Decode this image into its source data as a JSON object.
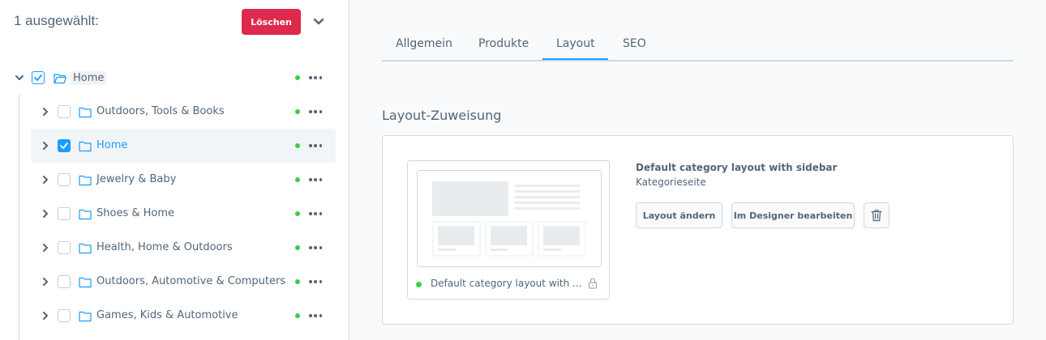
{
  "selection": {
    "title": "1 ausgewählt:",
    "delete_label": "Löschen"
  },
  "tree": {
    "root": {
      "label": "Home",
      "checked": true
    },
    "items": [
      {
        "label": "Outdoors, Tools & Books",
        "checked": false,
        "active": false
      },
      {
        "label": "Home",
        "checked": true,
        "active": true
      },
      {
        "label": "Jewelry & Baby",
        "checked": false,
        "active": false
      },
      {
        "label": "Shoes & Home",
        "checked": false,
        "active": false
      },
      {
        "label": "Health, Home & Outdoors",
        "checked": false,
        "active": false
      },
      {
        "label": "Outdoors, Automotive & Computers",
        "checked": false,
        "active": false
      },
      {
        "label": "Games, Kids & Automotive",
        "checked": false,
        "active": false
      }
    ]
  },
  "tabs": [
    {
      "label": "Allgemein"
    },
    {
      "label": "Produkte"
    },
    {
      "label": "Layout",
      "active": true
    },
    {
      "label": "SEO"
    }
  ],
  "layout": {
    "section_title": "Layout-Zuweisung",
    "preview_name": "Default category layout with ...",
    "title": "Default category layout with sidebar",
    "subtitle": "Kategorieseite",
    "change_label": "Layout ändern",
    "designer_label": "Im Designer bearbeiten"
  },
  "colors": {
    "accent": "#189eff",
    "danger": "#de294c",
    "active_dot": "#37d046",
    "text": "#52667a"
  }
}
